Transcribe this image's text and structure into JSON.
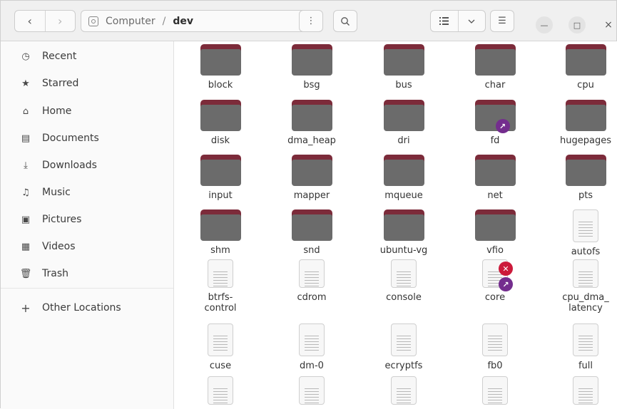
{
  "header": {
    "back_icon": "‹",
    "forward_icon": "›",
    "path": {
      "root": "Computer",
      "separator": "/",
      "current": "dev"
    },
    "menu_icon": "⋮",
    "search_icon": "search-icon",
    "view_list_icon": "list-view-icon",
    "view_dropdown_icon": "chevron-down-icon",
    "hamburger_icon": "☰",
    "minimize_icon": "—",
    "maximize_icon": "□",
    "close_icon": "×"
  },
  "sidebar": {
    "items": [
      {
        "label": "Recent",
        "icon": "clock-icon",
        "glyph": "◷"
      },
      {
        "label": "Starred",
        "icon": "star-icon",
        "glyph": "★"
      },
      {
        "label": "Home",
        "icon": "home-icon",
        "glyph": "⌂"
      },
      {
        "label": "Documents",
        "icon": "document-icon",
        "glyph": "▤"
      },
      {
        "label": "Downloads",
        "icon": "download-icon",
        "glyph": "⤓"
      },
      {
        "label": "Music",
        "icon": "music-icon",
        "glyph": "♫"
      },
      {
        "label": "Pictures",
        "icon": "picture-icon",
        "glyph": "▣"
      },
      {
        "label": "Videos",
        "icon": "video-icon",
        "glyph": "▦"
      },
      {
        "label": "Trash",
        "icon": "trash-icon",
        "glyph": "🗑"
      },
      {
        "label": "Other Locations",
        "icon": "plus-icon",
        "glyph": "+"
      }
    ]
  },
  "files": [
    {
      "name": "block",
      "type": "folder"
    },
    {
      "name": "bsg",
      "type": "folder"
    },
    {
      "name": "bus",
      "type": "folder"
    },
    {
      "name": "char",
      "type": "folder"
    },
    {
      "name": "cpu",
      "type": "folder"
    },
    {
      "name": "disk",
      "type": "folder"
    },
    {
      "name": "dma_heap",
      "type": "folder"
    },
    {
      "name": "dri",
      "type": "folder"
    },
    {
      "name": "fd",
      "type": "folder",
      "emblem": "link"
    },
    {
      "name": "hugepages",
      "type": "folder"
    },
    {
      "name": "input",
      "type": "folder"
    },
    {
      "name": "mapper",
      "type": "folder"
    },
    {
      "name": "mqueue",
      "type": "folder"
    },
    {
      "name": "net",
      "type": "folder"
    },
    {
      "name": "pts",
      "type": "folder"
    },
    {
      "name": "shm",
      "type": "folder"
    },
    {
      "name": "snd",
      "type": "folder"
    },
    {
      "name": "ubuntu-vg",
      "type": "folder"
    },
    {
      "name": "vfio",
      "type": "folder"
    },
    {
      "name": "autofs",
      "type": "file"
    },
    {
      "name": "btrfs-\ncontrol",
      "type": "file"
    },
    {
      "name": "cdrom",
      "type": "file"
    },
    {
      "name": "console",
      "type": "file"
    },
    {
      "name": "core",
      "type": "file",
      "emblem": "link",
      "emblem2": "noread"
    },
    {
      "name": "cpu_dma_\nlatency",
      "type": "file"
    },
    {
      "name": "cuse",
      "type": "file"
    },
    {
      "name": "dm-0",
      "type": "file"
    },
    {
      "name": "ecryptfs",
      "type": "file"
    },
    {
      "name": "fb0",
      "type": "file"
    },
    {
      "name": "full",
      "type": "file"
    },
    {
      "name": "",
      "type": "file"
    },
    {
      "name": "",
      "type": "file"
    },
    {
      "name": "",
      "type": "file"
    },
    {
      "name": "",
      "type": "file"
    },
    {
      "name": "",
      "type": "file"
    }
  ],
  "colors": {
    "folder_tab": "#7c2b3a",
    "folder_body": "#6b6b6b",
    "link_emblem": "#742d8e",
    "noread_emblem": "#cc1a3a"
  }
}
